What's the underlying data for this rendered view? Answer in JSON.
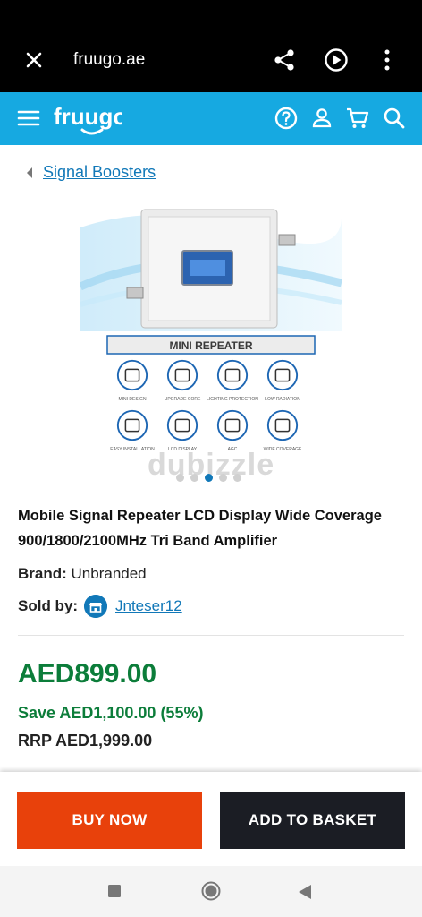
{
  "browser": {
    "url": "fruugo.ae",
    "icons": [
      "close-icon",
      "share-icon",
      "play-circle-icon",
      "more-vert-icon"
    ]
  },
  "header": {
    "logo": "fruugo",
    "brand_color": "#16a9e1",
    "icons": [
      "menu-icon",
      "help-icon",
      "account-icon",
      "cart-icon",
      "search-icon"
    ]
  },
  "breadcrumb": {
    "label": "Signal Boosters"
  },
  "image": {
    "banner": "MINI REPEATER",
    "features": [
      {
        "label": "MINI DESIGN",
        "icon": "mini-design-icon"
      },
      {
        "label": "UPGRADE CORE",
        "icon": "chip-icon"
      },
      {
        "label": "LIGHTING PROTECTION",
        "icon": "lightning-icon"
      },
      {
        "label": "LOW RADIATION",
        "icon": "radiation-icon"
      },
      {
        "label": "EASY INSTALLATION",
        "icon": "wrench-icon"
      },
      {
        "label": "LCD DISPLAY",
        "icon": "lcd-icon"
      },
      {
        "label": "AGC",
        "icon": "agc-icon"
      },
      {
        "label": "WIDE COVERAGE",
        "icon": "signal-tower-icon"
      }
    ],
    "dots_total": 5,
    "dots_active": 3
  },
  "watermark": "dubizzle",
  "product": {
    "title": "Mobile Signal Repeater LCD Display Wide Coverage 900/1800/2100MHz Tri Band Amplifier",
    "brand_label": "Brand:",
    "brand_value": "Unbranded",
    "sold_label": "Sold by:",
    "seller": "Jnteser12"
  },
  "pricing": {
    "price": "AED899.00",
    "save": "Save AED1,100.00 (55%)",
    "rrp_label": "RRP",
    "rrp_value": "AED1,999.00",
    "price_color": "#0c7d3a"
  },
  "actions": {
    "buy_now": "BUY NOW",
    "add_to_basket": "ADD TO BASKET",
    "buy_color": "#e8410b",
    "basket_color": "#1b1d24"
  },
  "nav": {
    "icons": [
      "recent-apps-icon",
      "home-icon",
      "back-icon"
    ]
  }
}
